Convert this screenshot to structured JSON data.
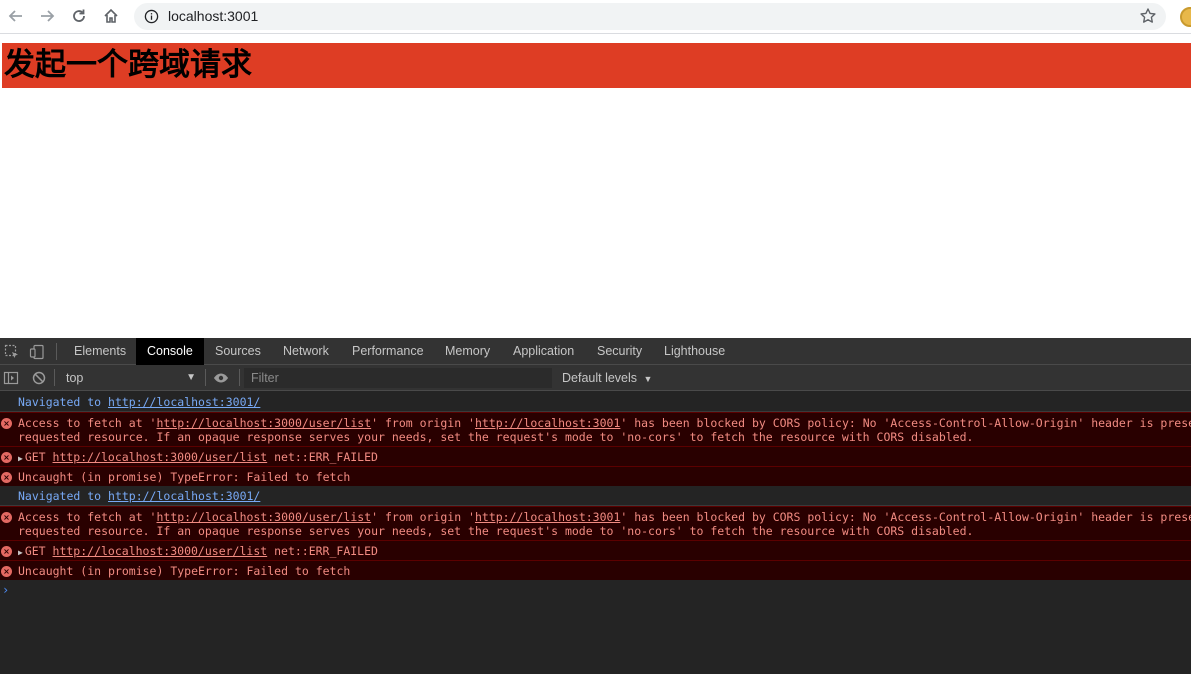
{
  "browser": {
    "url": "localhost:3001"
  },
  "page": {
    "heading": "发起一个跨域请求",
    "banner_color": "#de3d24"
  },
  "devtools": {
    "tabs": [
      {
        "label": "Elements",
        "active": false
      },
      {
        "label": "Console",
        "active": true
      },
      {
        "label": "Sources",
        "active": false
      },
      {
        "label": "Network",
        "active": false
      },
      {
        "label": "Performance",
        "active": false
      },
      {
        "label": "Memory",
        "active": false
      },
      {
        "label": "Application",
        "active": false
      },
      {
        "label": "Security",
        "active": false
      },
      {
        "label": "Lighthouse",
        "active": false
      }
    ],
    "context": "top",
    "filter_placeholder": "Filter",
    "levels": "Default levels",
    "messages": [
      {
        "type": "info",
        "prefix": "Navigated to ",
        "link": "http://localhost:3001/"
      },
      {
        "type": "error",
        "parts": [
          "Access to fetch at '",
          {
            "u": "http://localhost:3000/user/list"
          },
          "' from origin '",
          {
            "u": "http://localhost:3001"
          },
          "' has been blocked by CORS policy: No 'Access-Control-Allow-Origin' header is present on the\nrequested resource. If an opaque response serves your needs, set the request's mode to 'no-cors' to fetch the resource with CORS disabled."
        ]
      },
      {
        "type": "error",
        "expandable": true,
        "parts": [
          "GET ",
          {
            "u": "http://localhost:3000/user/list"
          },
          " net::ERR_FAILED"
        ]
      },
      {
        "type": "error",
        "parts": [
          "Uncaught (in promise) TypeError: Failed to fetch"
        ]
      },
      {
        "type": "info",
        "prefix": "Navigated to ",
        "link": "http://localhost:3001/"
      },
      {
        "type": "error",
        "parts": [
          "Access to fetch at '",
          {
            "u": "http://localhost:3000/user/list"
          },
          "' from origin '",
          {
            "u": "http://localhost:3001"
          },
          "' has been blocked by CORS policy: No 'Access-Control-Allow-Origin' header is present on the\nrequested resource. If an opaque response serves your needs, set the request's mode to 'no-cors' to fetch the resource with CORS disabled."
        ]
      },
      {
        "type": "error",
        "expandable": true,
        "parts": [
          "GET ",
          {
            "u": "http://localhost:3000/user/list"
          },
          " net::ERR_FAILED"
        ]
      },
      {
        "type": "error",
        "parts": [
          "Uncaught (in promise) TypeError: Failed to fetch"
        ]
      }
    ],
    "prompt_symbol": "›"
  }
}
